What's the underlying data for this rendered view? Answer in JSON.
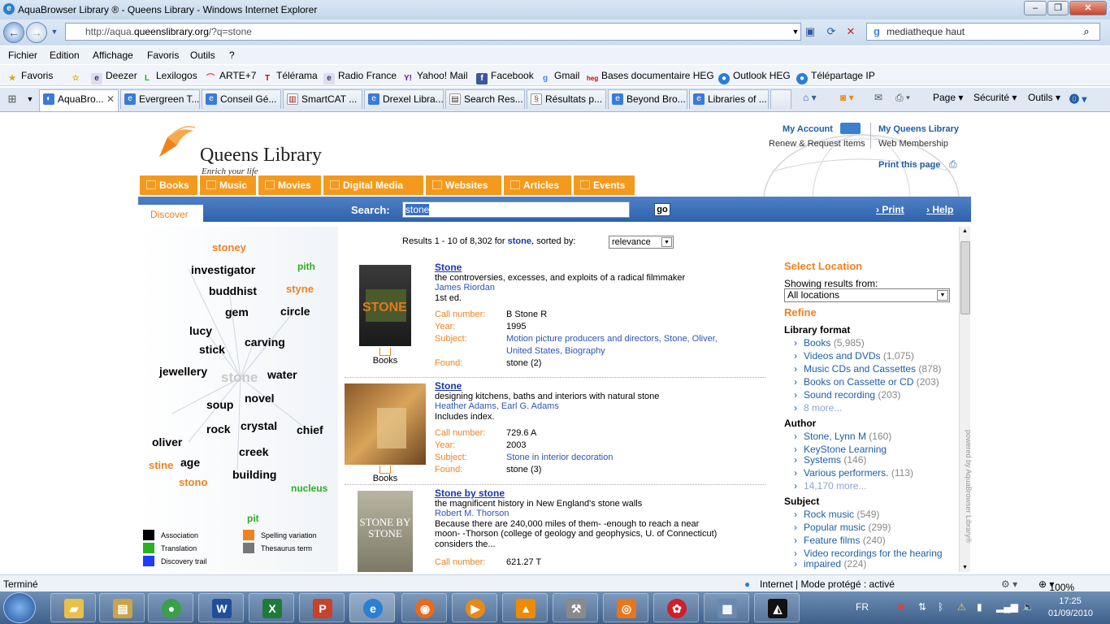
{
  "window": {
    "title": "AquaBrowser Library ® - Queens Library - Windows Internet Explorer"
  },
  "address": {
    "prefix": "http://aqua.",
    "domain": "queenslibrary.org",
    "suffix": "/?q=stone"
  },
  "websearch": {
    "value": "mediatheque haut"
  },
  "menu": [
    "Fichier",
    "Edition",
    "Affichage",
    "Favoris",
    "Outils",
    "?"
  ],
  "favorites": {
    "label": "Favoris",
    "items": [
      "Deezer",
      "Lexilogos",
      "ARTE+7",
      "Télérama",
      "Radio France",
      "Yahoo! Mail",
      "Facebook",
      "Gmail",
      "Bases documentaire HEG",
      "Outlook HEG",
      "Télépartage IP"
    ]
  },
  "tabs": [
    "AquaBro...",
    "Evergreen T...",
    "Conseil Gé...",
    "SmartCAT ...",
    "Drexel Libra...",
    "Search Res...",
    "Résultats p...",
    "Beyond Bro...",
    "Libraries of ..."
  ],
  "commands": [
    "Page",
    "Sécurité",
    "Outils"
  ],
  "site": {
    "logo_name": "Queens Library",
    "logo_tag": "Enrich your life",
    "my_account": "My Account",
    "renew": "Renew & Request Items",
    "my_queens": "My Queens Library",
    "membership": "Web Membership",
    "print_page": "Print this page",
    "categories": [
      "Books",
      "Music",
      "Movies",
      "Digital Media",
      "Websites",
      "Articles",
      "Events"
    ],
    "discover": "Discover",
    "search_label": "Search:",
    "search_value": "stone",
    "go": "go",
    "print": "Print",
    "help": "Help"
  },
  "cloud": {
    "center": "stone",
    "words": [
      "stoney",
      "investigator",
      "pith",
      "buddhist",
      "styne",
      "gem",
      "circle",
      "lucy",
      "carving",
      "stick",
      "jewellery",
      "water",
      "novel",
      "soup",
      "rock",
      "crystal",
      "chief",
      "oliver",
      "creek",
      "stine",
      "age",
      "building",
      "stono",
      "nucleus",
      "pit"
    ],
    "legend": [
      "Association",
      "Spelling variation",
      "Translation",
      "Thesaurus term",
      "Discovery trail"
    ],
    "colors": {
      "association": "#000000",
      "spelling": "#f0821e",
      "translation": "#29b11f",
      "thesaurus": "#777777",
      "trail": "#1f3cff"
    }
  },
  "results": {
    "summary_pre": "Results 1 - 10 of 8,302 for ",
    "query": "stone",
    "summary_post": ", sorted by:",
    "sort": "relevance",
    "labels": {
      "call": "Call number:",
      "year": "Year:",
      "subject": "Subject:",
      "found": "Found:"
    },
    "items": [
      {
        "title": "Stone",
        "subtitle": "the controversies, excesses, and exploits of a radical filmmaker",
        "author": "James Riordan",
        "note": "1st ed.",
        "call": "B Stone R",
        "year": "1995",
        "subject1": "Motion picture producers and directors, Stone, Oliver,",
        "subject2": "United States, Biography",
        "found": "stone (2)",
        "format": "Books",
        "cover_text": "STONE"
      },
      {
        "title": "Stone",
        "subtitle": "designing kitchens, baths and interiors with natural stone",
        "author": "Heather Adams, Earl G. Adams",
        "note": "Includes index.",
        "call": "729.6 A",
        "year": "2003",
        "subject1": "Stone in interior decoration",
        "found": "stone (3)",
        "format": "Books"
      },
      {
        "title": "Stone by stone",
        "subtitle": "the magnificent history in New England's stone walls",
        "author": "Robert M. Thorson",
        "note1": "Because there are 240,000 miles of them- -enough to reach a near",
        "note2": "moon- -Thorson (college of geology and geophysics, U. of Connecticut)",
        "note3": "considers the...",
        "call": "621.27 T",
        "cover_text": "STONE BY STONE"
      }
    ]
  },
  "facets": {
    "select_location": "Select Location",
    "showing": "Showing results from:",
    "location": "All locations",
    "refine": "Refine",
    "format_h": "Library format",
    "formats": [
      {
        "n": "Books",
        "c": "(5,985)"
      },
      {
        "n": "Videos and DVDs",
        "c": "(1,075)"
      },
      {
        "n": "Music CDs and Cassettes",
        "c": "(878)"
      },
      {
        "n": "Books on Cassette or CD",
        "c": "(203)"
      },
      {
        "n": "Sound recording",
        "c": "(203)"
      },
      {
        "n": "8 more...",
        "c": ""
      }
    ],
    "author_h": "Author",
    "authors": [
      {
        "n": "Stone, Lynn M",
        "c": "(160)"
      },
      {
        "n": "KeyStone Learning",
        "c": ""
      },
      {
        "n": "Systems",
        "c": "(146)"
      },
      {
        "n": "Various performers.",
        "c": "(113)"
      },
      {
        "n": "14,170 more...",
        "c": ""
      }
    ],
    "subject_h": "Subject",
    "subjects": [
      {
        "n": "Rock music",
        "c": "(549)"
      },
      {
        "n": "Popular music",
        "c": "(299)"
      },
      {
        "n": "Feature films",
        "c": "(240)"
      },
      {
        "n": "Video recordings for the hearing",
        "c": ""
      },
      {
        "n": "impaired",
        "c": "(224)"
      }
    ],
    "powered": "powered by AquaBrowser Library®"
  },
  "status": {
    "left": "Terminé",
    "zone": "Internet | Mode protégé : activé",
    "zoom": "100%"
  },
  "taskbar": {
    "lang": "FR",
    "time": "17:25",
    "date": "01/09/2010"
  }
}
